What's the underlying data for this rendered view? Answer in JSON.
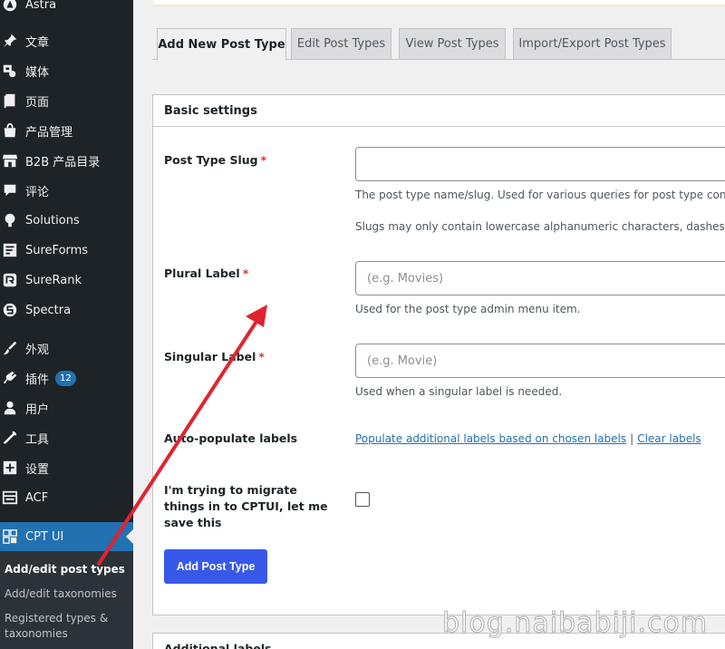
{
  "sidebar": {
    "items": [
      {
        "label": "Astra",
        "icon": "astra-icon"
      },
      {
        "label": "文章",
        "icon": "pin-icon"
      },
      {
        "label": "媒体",
        "icon": "media-icon"
      },
      {
        "label": "页面",
        "icon": "page-icon"
      },
      {
        "label": "产品管理",
        "icon": "store-icon"
      },
      {
        "label": "B2B 产品目录",
        "icon": "shop-icon"
      },
      {
        "label": "评论",
        "icon": "comment-icon"
      },
      {
        "label": "Solutions",
        "icon": "bulb-icon"
      },
      {
        "label": "SureForms",
        "icon": "form-icon"
      },
      {
        "label": "SureRank",
        "icon": "rank-icon"
      },
      {
        "label": "Spectra",
        "icon": "spectra-icon"
      },
      {
        "label": "外观",
        "icon": "brush-icon"
      },
      {
        "label": "插件",
        "icon": "plugin-icon",
        "badge": "12"
      },
      {
        "label": "用户",
        "icon": "user-icon"
      },
      {
        "label": "工具",
        "icon": "wrench-icon"
      },
      {
        "label": "设置",
        "icon": "settings-icon"
      },
      {
        "label": "ACF",
        "icon": "acf-icon"
      },
      {
        "label": "CPT UI",
        "icon": "cptui-icon"
      }
    ],
    "submenu": [
      {
        "label": "Add/edit post types"
      },
      {
        "label": "Add/edit taxonomies"
      },
      {
        "label": "Registered types & taxonomies"
      }
    ]
  },
  "tabs": [
    {
      "label": "Add New Post Type"
    },
    {
      "label": "Edit Post Types"
    },
    {
      "label": "View Post Types"
    },
    {
      "label": "Import/Export Post Types"
    }
  ],
  "panel": {
    "title": "Basic settings",
    "slug_label": "Post Type Slug",
    "slug_value": "",
    "slug_help_1": "The post type name/slug. Used for various queries for post type conte",
    "slug_help_2": "Slugs may only contain lowercase alphanumeric characters, dashes, a",
    "plural_label": "Plural Label",
    "plural_placeholder": "(e.g. Movies)",
    "plural_help": "Used for the post type admin menu item.",
    "singular_label": "Singular Label",
    "singular_placeholder": "(e.g. Movie)",
    "singular_help": "Used when a singular label is needed.",
    "auto_label": "Auto-populate labels",
    "populate_link": "Populate additional labels based on chosen labels",
    "separator": "|",
    "clear_link": "Clear labels",
    "migrate_label": "I'm trying to migrate things in to CPTUI, let me save this",
    "required_mark": "*",
    "submit_label": "Add Post Type"
  },
  "panel2": {
    "title": "Additional labels"
  },
  "watermark": "blog.naibabiji.com",
  "colors": {
    "sidebar_bg": "#1d2327",
    "accent": "#2271b1",
    "button": "#3858e9",
    "arrow": "#e0242f"
  }
}
